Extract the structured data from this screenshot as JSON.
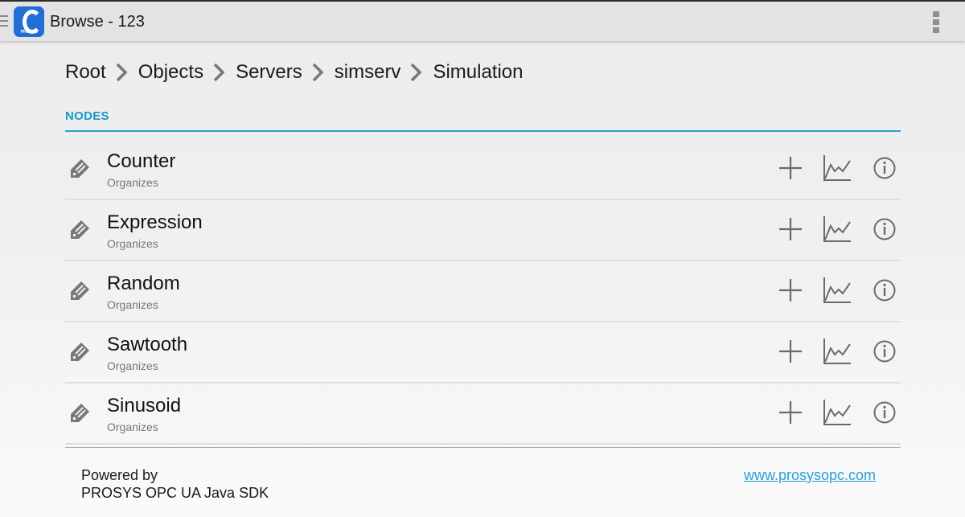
{
  "app": {
    "title": "Browse - 123",
    "logo_text": "PROSYS"
  },
  "breadcrumb": [
    "Root",
    "Objects",
    "Servers",
    "simserv",
    "Simulation"
  ],
  "section": {
    "label": "NODES",
    "accent_color": "#2aa0d4"
  },
  "nodes": [
    {
      "name": "Counter",
      "reference": "Organizes",
      "icon": "tag-icon"
    },
    {
      "name": "Expression",
      "reference": "Organizes",
      "icon": "tag-icon"
    },
    {
      "name": "Random",
      "reference": "Organizes",
      "icon": "tag-icon"
    },
    {
      "name": "Sawtooth",
      "reference": "Organizes",
      "icon": "tag-icon"
    },
    {
      "name": "Sinusoid",
      "reference": "Organizes",
      "icon": "tag-icon"
    }
  ],
  "row_actions": [
    "add-icon",
    "chart-icon",
    "info-icon"
  ],
  "footer": {
    "powered_by": "Powered by",
    "sdk": "PROSYS OPC UA Java SDK",
    "link": "www.prosysopc.com"
  }
}
